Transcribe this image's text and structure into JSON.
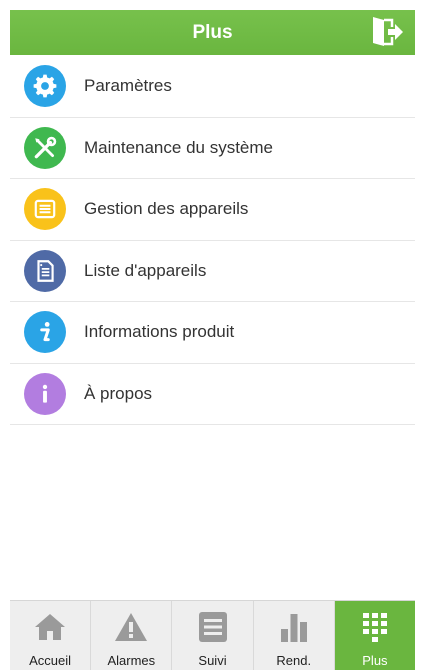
{
  "header": {
    "title": "Plus",
    "logout_icon": "logout-door-icon"
  },
  "menu": [
    {
      "label": "Paramètres",
      "icon": "gear-icon",
      "color": "#2aa4e6"
    },
    {
      "label": "Maintenance du système",
      "icon": "wrench-screwdriver-icon",
      "color": "#3fb84f"
    },
    {
      "label": "Gestion des appareils",
      "icon": "list-icon",
      "color": "#f9c21a"
    },
    {
      "label": "Liste d'appareils",
      "icon": "document-list-icon",
      "color": "#4f6aa6"
    },
    {
      "label": "Informations produit",
      "icon": "info-italic-icon",
      "color": "#2aa4e6"
    },
    {
      "label": "À propos",
      "icon": "info-icon",
      "color": "#b27de0"
    }
  ],
  "tabs": [
    {
      "label": "Accueil",
      "icon": "home-icon",
      "active": false
    },
    {
      "label": "Alarmes",
      "icon": "warning-icon",
      "active": false
    },
    {
      "label": "Suivi",
      "icon": "lines-icon",
      "active": false
    },
    {
      "label": "Rend.",
      "icon": "bar-chart-icon",
      "active": false
    },
    {
      "label": "Plus",
      "icon": "grid-icon",
      "active": true
    }
  ],
  "colors": {
    "accent": "#6ab63f",
    "tabbar_bg": "#eeeeee",
    "tab_icon": "#9a9a9a"
  }
}
